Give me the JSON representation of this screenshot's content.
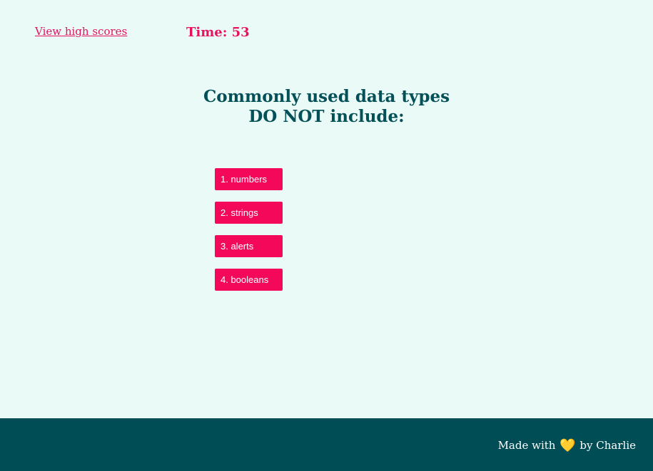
{
  "header": {
    "high_scores_link": "View high scores",
    "timer_label": "Time: ",
    "timer_value": "53"
  },
  "question": {
    "line1": "Commonly used data types",
    "line2": "DO NOT include:"
  },
  "answers": [
    {
      "label": "1. numbers"
    },
    {
      "label": "2. strings"
    },
    {
      "label": "3. alerts"
    },
    {
      "label": "4. booleans"
    }
  ],
  "footer": {
    "made_with": "Made with",
    "heart_icon": "💛",
    "by": "by Charlie"
  },
  "colors": {
    "background": "#eafaf6",
    "accent": "#f4095a",
    "heading": "#035058",
    "footer": "#004d55",
    "heart": "#f9c433"
  }
}
